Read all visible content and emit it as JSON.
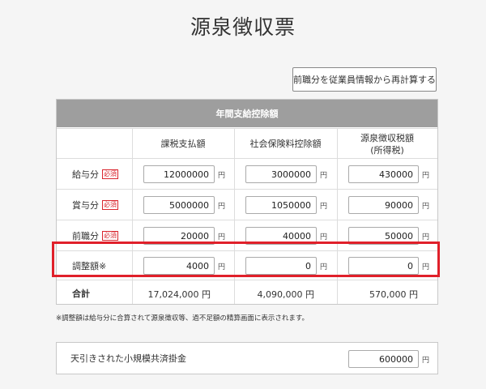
{
  "page": {
    "title": "源泉徴収票"
  },
  "toolbar": {
    "recalc_label": "前職分を従業員情報から再計算する"
  },
  "table": {
    "header": "年間支給控除額",
    "columns": [
      "課税支払額",
      "社会保険料控除額",
      "源泉徴収税額\n(所得税)"
    ],
    "yen": "円",
    "required_badge": "必須",
    "rows": [
      {
        "label": "給与分",
        "required": true,
        "values": [
          "12000000",
          "3000000",
          "430000"
        ]
      },
      {
        "label": "賞与分",
        "required": true,
        "values": [
          "5000000",
          "1050000",
          "90000"
        ]
      },
      {
        "label": "前職分",
        "required": true,
        "values": [
          "20000",
          "40000",
          "50000"
        ]
      },
      {
        "label": "調整額※",
        "required": false,
        "values": [
          "4000",
          "0",
          "0"
        ]
      }
    ],
    "total": {
      "label": "合計",
      "values": [
        "17,024,000 円",
        "4,090,000 円",
        "570,000 円"
      ]
    }
  },
  "note": "※調整額は給与分に合算されて源泉徴収等、過不足額の精算画面に表示されます。",
  "deduction": {
    "label": "天引きされた小規模共済掛金",
    "value": "600000",
    "yen": "円"
  },
  "colors": {
    "highlight": "#e0202a",
    "header_bg": "#9e9e9e",
    "required": "#d9262e"
  }
}
